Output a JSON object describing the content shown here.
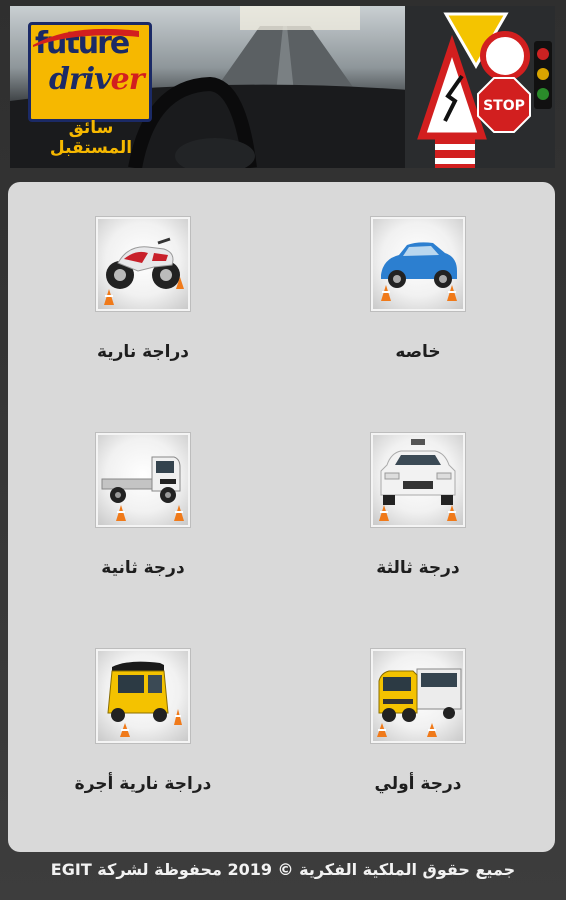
{
  "banner": {
    "logo_word1": "future",
    "logo_word2_main": "driv",
    "logo_word2_accent": "er",
    "logo_arabic": "سائق المستقبل",
    "sign_text": "STOP"
  },
  "licenses": [
    {
      "label": "خاصه",
      "icon": "blue-car-icon"
    },
    {
      "label": "دراجة نارية",
      "icon": "motorcycle-icon"
    },
    {
      "label": "درجة ثالثة",
      "icon": "taxi-car-icon"
    },
    {
      "label": "درجة ثانية",
      "icon": "truck-icon"
    },
    {
      "label": "درجة أولي",
      "icon": "bus-truck-icon"
    },
    {
      "label": "دراجة نارية أجرة",
      "icon": "tuk-tuk-icon"
    }
  ],
  "footer": {
    "copyright": "جميع حقوق الملكية الفكرية © 2019 محفوظة لشركة EGIT"
  },
  "colors": {
    "background": "#3a3a3a",
    "panel": "#d9d9d9",
    "logo_yellow": "#f6b800",
    "logo_navy": "#1b2a66",
    "accent_red": "#d21f1f"
  }
}
